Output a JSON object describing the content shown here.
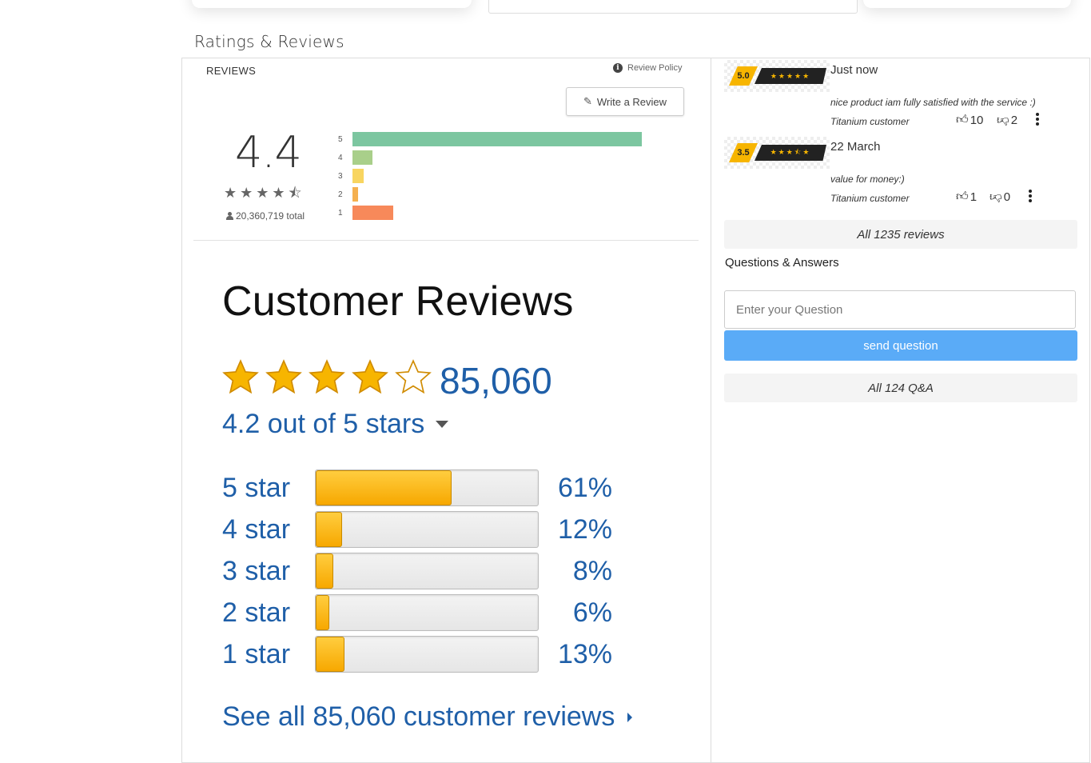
{
  "section_title": "Ratings & Reviews",
  "google_widget": {
    "header": "REVIEWS",
    "policy_label": "Review Policy",
    "write_review_label": "Write a Review",
    "average": "4.4",
    "stars": "★★★★⯪",
    "total": "20,360,719 total",
    "histogram": [
      {
        "label": "5",
        "fraction": 1.0,
        "color": "#7cc6a0"
      },
      {
        "label": "4",
        "fraction": 0.07,
        "color": "#a9cf8a"
      },
      {
        "label": "3",
        "fraction": 0.04,
        "color": "#f8d560"
      },
      {
        "label": "2",
        "fraction": 0.02,
        "color": "#f5b04f"
      },
      {
        "label": "1",
        "fraction": 0.14,
        "color": "#f7895a"
      }
    ]
  },
  "amazon_image": {
    "title": "Customer Reviews",
    "count": "85,060",
    "out_of": "4.2 out of 5 stars",
    "rows": [
      {
        "label": "5 star",
        "pct": "61%",
        "fraction": 0.61
      },
      {
        "label": "4 star",
        "pct": "12%",
        "fraction": 0.12
      },
      {
        "label": "3 star",
        "pct": "8%",
        "fraction": 0.08
      },
      {
        "label": "2 star",
        "pct": "6%",
        "fraction": 0.06
      },
      {
        "label": "1 star",
        "pct": "13%",
        "fraction": 0.13
      }
    ],
    "see_all": "See all 85,060 customer reviews"
  },
  "reviews": [
    {
      "score": "5.0",
      "stars": "★★★★★",
      "date": "Just now",
      "text": "nice product iam fully satisfied with the service :)",
      "author": "Titanium customer",
      "likes": "10",
      "dislikes": "2"
    },
    {
      "score": "3.5",
      "stars": "★★★⯪★",
      "date": "22 March",
      "text": "value for money:)",
      "author": "Titanium customer",
      "likes": "1",
      "dislikes": "0"
    }
  ],
  "all_reviews_label": "All 1235 reviews",
  "qa": {
    "title": "Questions & Answers",
    "placeholder": "Enter your Question",
    "send_label": "send question",
    "all_label": "All 124 Q&A"
  },
  "colors": {
    "accent_blue": "#5aabf7",
    "amazon_blue": "#1f5fa8",
    "badge_gold": "#f7b500"
  }
}
